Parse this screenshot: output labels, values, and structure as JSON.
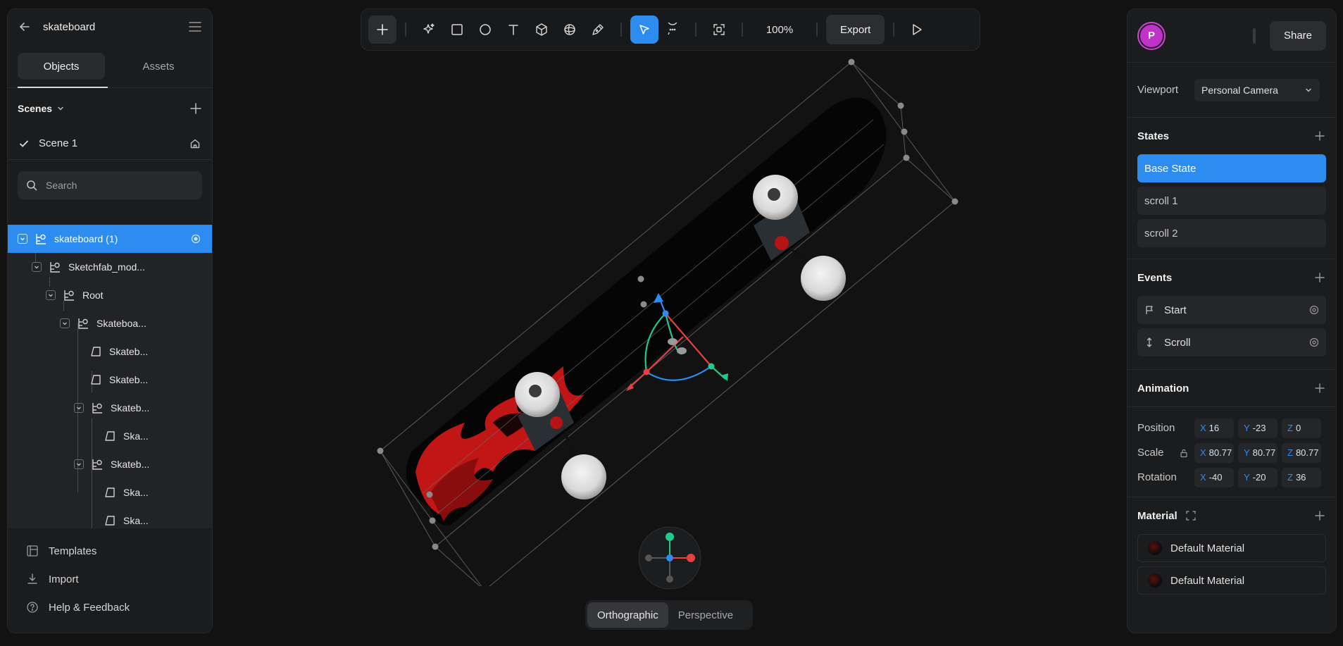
{
  "project": {
    "title": "skateboard"
  },
  "left_tabs": [
    {
      "label": "Objects"
    },
    {
      "label": "Assets"
    }
  ],
  "scenes": {
    "label": "Scenes",
    "items": [
      {
        "name": "Scene 1"
      }
    ]
  },
  "search": {
    "placeholder": "Search"
  },
  "tree": [
    {
      "label": "skateboard (1)"
    },
    {
      "label": "Sketchfab_mod..."
    },
    {
      "label": "Root"
    },
    {
      "label": "Skateboa..."
    },
    {
      "label": "Skateb..."
    },
    {
      "label": "Skateb..."
    },
    {
      "label": "Skateb..."
    },
    {
      "label": "Ska..."
    },
    {
      "label": "Skateb..."
    },
    {
      "label": "Ska..."
    },
    {
      "label": "Ska..."
    }
  ],
  "footer": [
    {
      "label": "Templates"
    },
    {
      "label": "Import"
    },
    {
      "label": "Help & Feedback"
    }
  ],
  "toolbar": {
    "zoom": "100%",
    "export": "Export"
  },
  "view_toggle": {
    "ortho": "Orthographic",
    "persp": "Perspective"
  },
  "right": {
    "avatar": "P",
    "share": "Share",
    "viewport_label": "Viewport",
    "viewport_value": "Personal Camera",
    "states_title": "States",
    "states": [
      {
        "label": "Base State"
      },
      {
        "label": "scroll 1"
      },
      {
        "label": "scroll 2"
      }
    ],
    "events_title": "Events",
    "events": [
      {
        "label": "Start"
      },
      {
        "label": "Scroll"
      }
    ],
    "animation_title": "Animation",
    "position": {
      "label": "Position",
      "x": "16",
      "y": "-23",
      "z": "0"
    },
    "scale": {
      "label": "Scale",
      "x": "80.77",
      "y": "80.77",
      "z": "80.77"
    },
    "rotation": {
      "label": "Rotation",
      "x": "-40",
      "y": "-20",
      "z": "36"
    },
    "material_title": "Material",
    "materials": [
      {
        "label": "Default Material"
      },
      {
        "label": "Default Material"
      }
    ]
  },
  "colors": {
    "accent": "#2d8cf0",
    "avatar": "#c231c9",
    "panel": "#1b1c1e",
    "canvas": "#121212"
  }
}
